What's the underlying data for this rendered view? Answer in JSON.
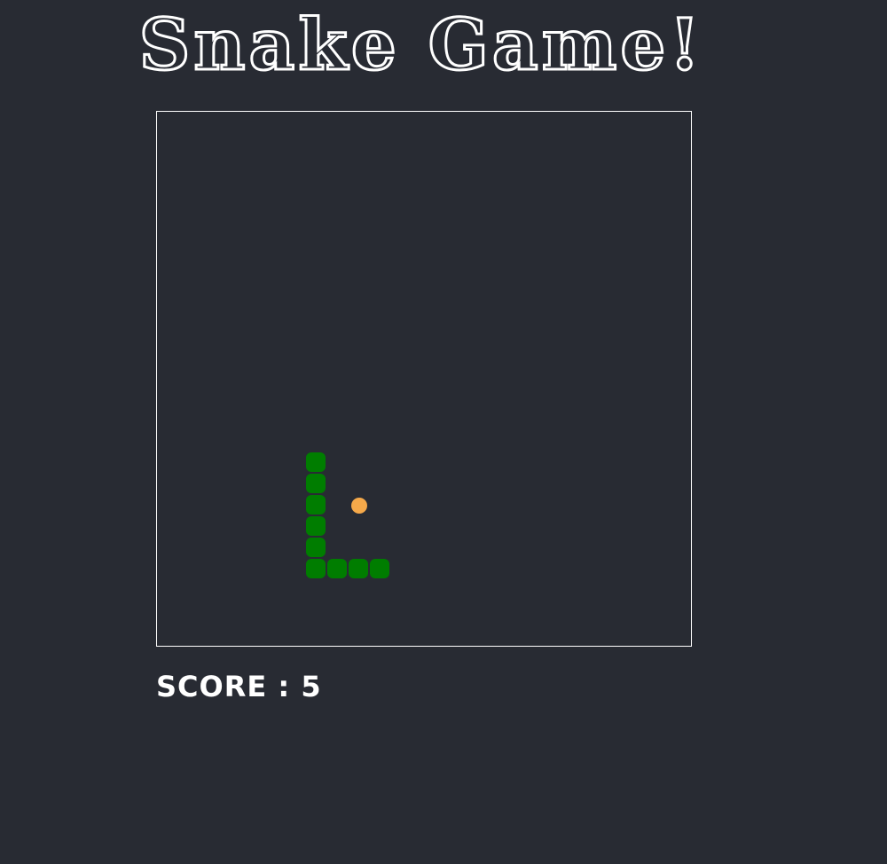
{
  "title": "Snake Game!",
  "score": {
    "text": "SCORE : 5",
    "value": 5
  },
  "board": {
    "background": "#282b33",
    "border_color": "#ffffff",
    "cols": 25,
    "rows": 25
  },
  "snake": {
    "color": "#007d00",
    "segments": [
      {
        "col": 7,
        "row": 16
      },
      {
        "col": 7,
        "row": 17
      },
      {
        "col": 7,
        "row": 18
      },
      {
        "col": 7,
        "row": 19
      },
      {
        "col": 7,
        "row": 20
      },
      {
        "col": 7,
        "row": 21
      },
      {
        "col": 8,
        "row": 21
      },
      {
        "col": 9,
        "row": 21
      },
      {
        "col": 10,
        "row": 21
      }
    ]
  },
  "food": {
    "color": "#f5a94a",
    "col": 9,
    "row": 18
  }
}
